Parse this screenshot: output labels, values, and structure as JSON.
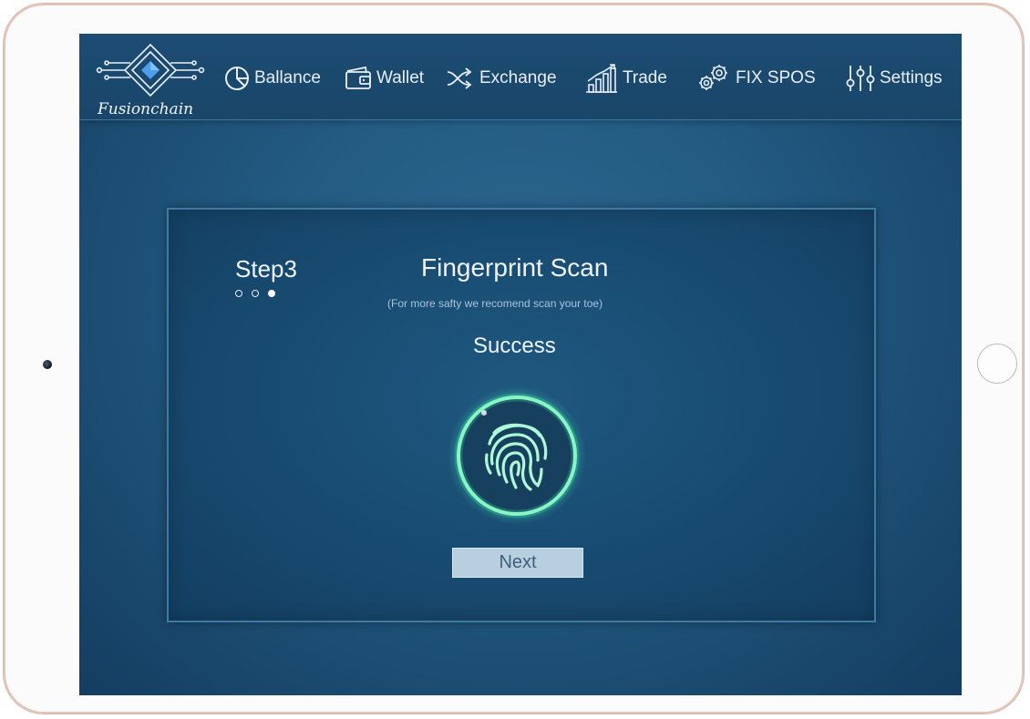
{
  "app": {
    "name": "Fusionchain"
  },
  "nav": {
    "items": [
      {
        "label": "Ballance",
        "icon": "pie-chart-icon"
      },
      {
        "label": "Wallet",
        "icon": "wallet-icon"
      },
      {
        "label": "Exchange",
        "icon": "shuffle-icon"
      },
      {
        "label": "Trade",
        "icon": "bar-chart-icon"
      },
      {
        "label": "FIX SPOS",
        "icon": "gears-icon"
      },
      {
        "label": "Settings",
        "icon": "sliders-icon"
      }
    ]
  },
  "wizard": {
    "step_label": "Step3",
    "step_count": 3,
    "current_step": 3,
    "title": "Fingerprint Scan",
    "subtitle": "(For more safty we recomend scan your toe)",
    "status": "Success",
    "next_label": "Next"
  },
  "colors": {
    "accent_glow": "#3ff0a8",
    "panel_bg": "#184a70",
    "button_bg": "#b8cfe0"
  }
}
